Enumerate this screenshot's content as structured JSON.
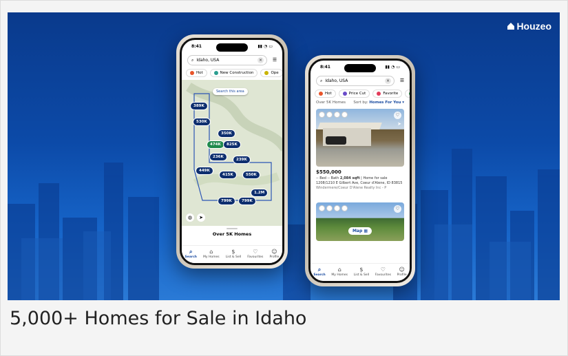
{
  "brand": {
    "name": "Houzeo"
  },
  "caption": "5,000+ Homes for Sale in Idaho",
  "colors": {
    "hero_top": "#0a3a8c",
    "hero_bottom": "#2a7ad6",
    "pin": "#0d2e6e",
    "accent": "#1a4ba0"
  },
  "map_phone": {
    "time": "8:41",
    "search_value": "Idaho, USA",
    "chips": [
      "Hot",
      "New Construction",
      "Ope"
    ],
    "search_area_label": "Search this area",
    "pins": [
      "389K",
      "530K",
      "350K",
      "474K",
      "825K",
      "236K",
      "239K",
      "449K",
      "415K",
      "550K",
      "799K",
      "1.2M",
      "799K"
    ],
    "sheet_title": "Over 5K Homes",
    "tabs": [
      "Search",
      "My Homes",
      "List & Sell",
      "Favourites",
      "Profile"
    ]
  },
  "list_phone": {
    "time": "8:41",
    "search_value": "Idaho, USA",
    "chips": [
      "Hot",
      "Price Cut",
      "Favorite",
      "N"
    ],
    "count_label": "Over 5K Homes",
    "sort_label": "Sort by:",
    "sort_value": "Homes For You",
    "listing": {
      "price": "$550,000",
      "beds": "-- Bed",
      "baths": "-- Bath",
      "sqft": "2,084 sqft",
      "status": "Home for sale",
      "address": "1208/1210 E Gilbert Ave, Coeur d'Alene, ID 83815",
      "broker": "Windermere/Coeur D'Alene Realty Inc - P"
    },
    "map_button": "Map",
    "tabs": [
      "Search",
      "My Homes",
      "List & Sell",
      "Favourites",
      "Profile"
    ]
  }
}
